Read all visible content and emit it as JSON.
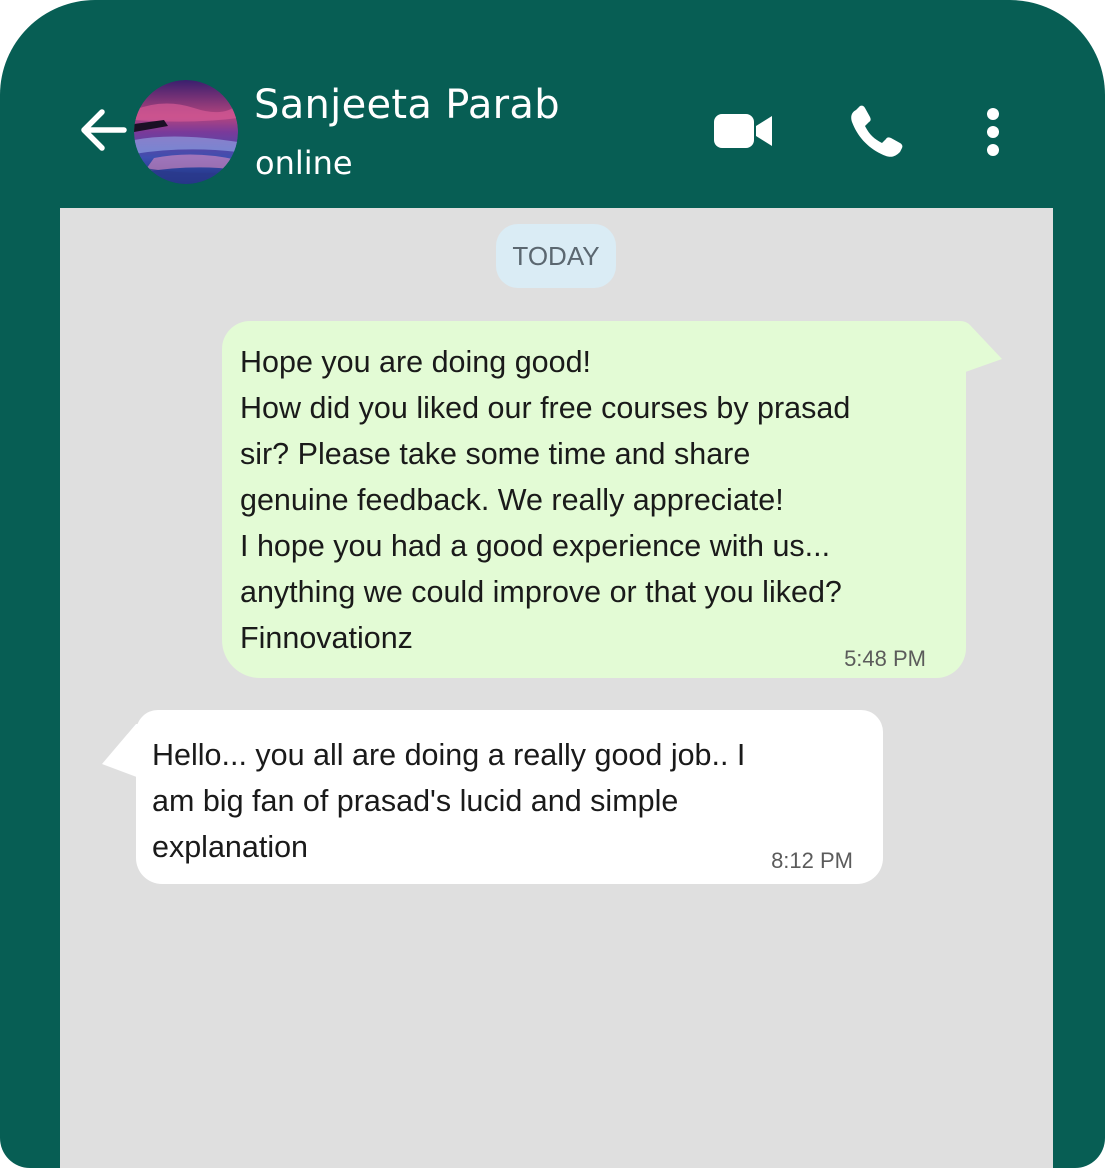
{
  "header": {
    "contact_name": "Sanjeeta Parab",
    "contact_status": "online",
    "icons": [
      "back-arrow-icon",
      "video-call-icon",
      "voice-call-icon",
      "more-options-icon"
    ]
  },
  "chat": {
    "date_label": "TODAY",
    "outgoing": {
      "lines": [
        "Hope you are doing good!",
        "How did you liked our free courses by prasad",
        "sir? Please take some time and share",
        "genuine feedback. We really appreciate!",
        "I hope you had a good experience with us...",
        "anything we could improve or that you liked?",
        "Finnovationz"
      ],
      "time": "5:48 PM"
    },
    "incoming": {
      "lines": [
        "Hello... you all are doing a really good job.. I",
        "am big fan of prasad's lucid and simple",
        "explanation"
      ],
      "time": "8:12 PM"
    }
  },
  "colors": {
    "header": "#075e54",
    "chat_background": "#dfdfdf",
    "outgoing_bubble": "#e3fbd5",
    "incoming_bubble": "#ffffff",
    "date_chip": "#daecf5"
  }
}
